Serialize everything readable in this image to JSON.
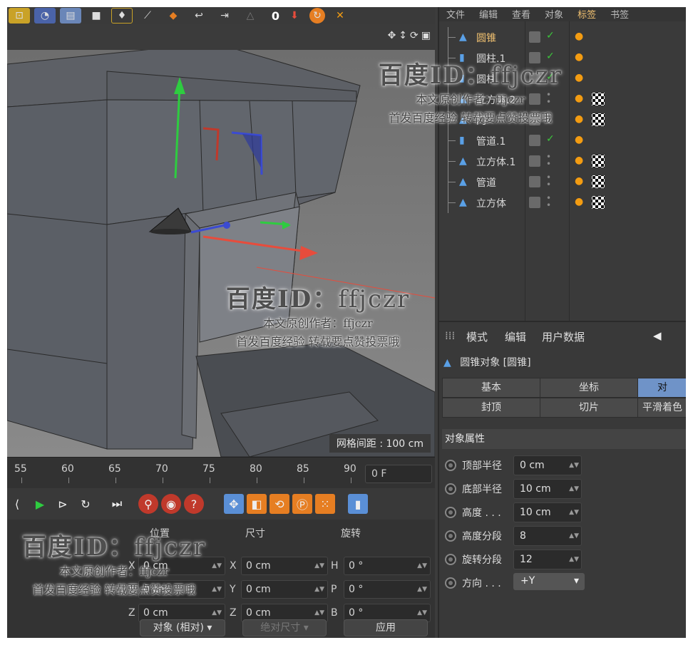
{
  "toolbar": {
    "counter": "0"
  },
  "object_manager": {
    "menu": [
      "文件",
      "编辑",
      "查看",
      "对象",
      "标签",
      "书签"
    ],
    "objects": [
      {
        "name": "圆锥",
        "icon": "cone-icon",
        "selected": true,
        "check": true,
        "texture": false
      },
      {
        "name": "圆柱.1",
        "icon": "cylinder-icon",
        "selected": false,
        "check": true,
        "texture": false
      },
      {
        "name": "圆柱",
        "icon": "cylinder-icon",
        "selected": false,
        "check": true,
        "texture": false
      },
      {
        "name": "立方体.2",
        "icon": "cube-icon",
        "selected": false,
        "check": false,
        "texture": true
      },
      {
        "name": "门",
        "icon": "cube-icon",
        "selected": false,
        "check": false,
        "texture": true
      },
      {
        "name": "管道.1",
        "icon": "tube-icon",
        "selected": false,
        "check": true,
        "texture": false
      },
      {
        "name": "立方体.1",
        "icon": "cube-icon",
        "selected": false,
        "check": false,
        "texture": true
      },
      {
        "name": "管道",
        "icon": "cube-icon",
        "selected": false,
        "check": false,
        "texture": true
      },
      {
        "name": "立方体",
        "icon": "cube-icon",
        "selected": false,
        "check": false,
        "texture": true
      }
    ]
  },
  "viewport": {
    "grid_spacing": "网格间距 : 100 cm"
  },
  "timeline": {
    "ticks": [
      "55",
      "60",
      "65",
      "70",
      "75",
      "80",
      "85",
      "90"
    ],
    "frame": "0 F"
  },
  "coords": {
    "headers": {
      "position": "位置",
      "size": "尺寸",
      "rotation": "旋转"
    },
    "rows": [
      {
        "pos_axis": "X",
        "pos": "0 cm",
        "size_axis": "X",
        "size": "0 cm",
        "rot_axis": "H",
        "rot": "0 °"
      },
      {
        "pos_axis": "Y",
        "pos": "0 cm",
        "size_axis": "Y",
        "size": "0 cm",
        "rot_axis": "P",
        "rot": "0 °"
      },
      {
        "pos_axis": "Z",
        "pos": "0 cm",
        "size_axis": "Z",
        "size": "0 cm",
        "rot_axis": "B",
        "rot": "0 °"
      }
    ],
    "mode": "对象 (相对)",
    "size_mode": "绝对尺寸",
    "apply": "应用"
  },
  "attributes": {
    "menu": {
      "mode": "模式",
      "edit": "编辑",
      "user_data": "用户数据"
    },
    "title": "圆锥对象 [圆锥]",
    "tabs": [
      {
        "label": "基本",
        "active": false
      },
      {
        "label": "坐标",
        "active": false
      },
      {
        "label": "对",
        "active": true
      },
      {
        "label": "封顶",
        "active": false
      },
      {
        "label": "切片",
        "active": false
      },
      {
        "label": "平滑着色",
        "active": false
      }
    ],
    "section": "对象属性",
    "props": [
      {
        "label": "顶部半径",
        "value": "0 cm"
      },
      {
        "label": "底部半径",
        "value": "10 cm"
      },
      {
        "label": "高度 . . .",
        "value": "10 cm"
      },
      {
        "label": "高度分段",
        "value": "8"
      },
      {
        "label": "旋转分段",
        "value": "12"
      },
      {
        "label": "方向 . . .",
        "value": "+Y"
      }
    ]
  },
  "watermark": {
    "title": "百度ID：",
    "id": "ffjczr",
    "line1": "本文原创作者：ffjczr",
    "line2": "首发百度经验 转载要点赞投票哦"
  }
}
